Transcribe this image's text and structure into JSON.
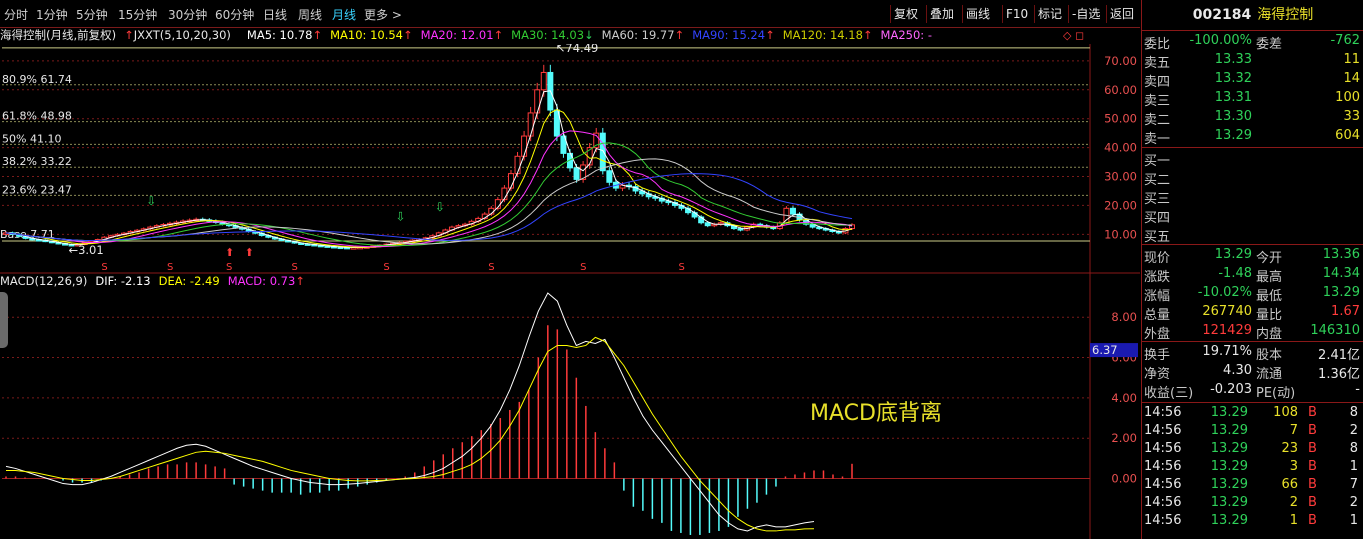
{
  "period_bar": {
    "items": [
      "分时",
      "1分钟",
      "5分钟",
      "15分钟",
      "30分钟",
      "60分钟",
      "日线",
      "周线",
      "月线",
      "更多 >"
    ],
    "active_index": 8,
    "tools": [
      "复权",
      "叠加",
      "画线",
      "F10",
      "标记",
      "-自选",
      "返回"
    ]
  },
  "ma_info": {
    "title": "海得控制(月线,前复权)",
    "indicator": "JXXT(5,10,20,30)",
    "ma5": "MA5: 10.78",
    "ma10": "MA10: 10.54",
    "ma20": "MA20: 12.01",
    "ma30": "MA30: 14.03",
    "ma60": "MA60: 19.77",
    "ma90": "MA90: 15.24",
    "ma120": "MA120: 14.18",
    "ma250": "MA250: -",
    "corner": "◇ ◻"
  },
  "macd_info": {
    "title": "MACD(12,26,9)",
    "dif": "DIF: -2.13",
    "dea": "DEA: -2.49",
    "macd": "MACD: 0.73"
  },
  "annotation": "MACD底背离",
  "stock": {
    "code": "002184",
    "name": "海得控制"
  },
  "order_book": {
    "ratio": {
      "label": "委比",
      "value": "-100.00%",
      "label2": "委差",
      "value2": "-762"
    },
    "asks": [
      {
        "label": "卖五",
        "price": "13.33",
        "vol": "11"
      },
      {
        "label": "卖四",
        "price": "13.32",
        "vol": "14"
      },
      {
        "label": "卖三",
        "price": "13.31",
        "vol": "100"
      },
      {
        "label": "卖二",
        "price": "13.30",
        "vol": "33"
      },
      {
        "label": "卖一",
        "price": "13.29",
        "vol": "604"
      }
    ],
    "bids": [
      {
        "label": "买一"
      },
      {
        "label": "买二"
      },
      {
        "label": "买三"
      },
      {
        "label": "买四"
      },
      {
        "label": "买五"
      }
    ]
  },
  "quote": [
    {
      "l1": "现价",
      "v1": "13.29",
      "l2": "今开",
      "v2": "13.36",
      "c1": "green",
      "c2": "green"
    },
    {
      "l1": "涨跌",
      "v1": "-1.48",
      "l2": "最高",
      "v2": "14.34",
      "c1": "green",
      "c2": "green"
    },
    {
      "l1": "涨幅",
      "v1": "-10.02%",
      "l2": "最低",
      "v2": "13.29",
      "c1": "green",
      "c2": "green"
    },
    {
      "l1": "总量",
      "v1": "267740",
      "l2": "量比",
      "v2": "1.67",
      "c1": "yellow",
      "c2": "red"
    },
    {
      "l1": "外盘",
      "v1": "121429",
      "l2": "内盘",
      "v2": "146310",
      "c1": "red",
      "c2": "green"
    }
  ],
  "fundamentals": [
    {
      "l1": "换手",
      "v1": "19.71%",
      "l2": "股本",
      "v2": "2.41亿"
    },
    {
      "l1": "净资",
      "v1": "4.30",
      "l2": "流通",
      "v2": "1.36亿"
    },
    {
      "l1": "收益(三)",
      "v1": "-0.203",
      "l2": "PE(动)",
      "v2": "-"
    }
  ],
  "ticks": [
    {
      "time": "14:56",
      "price": "13.29",
      "vol": "108",
      "side": "B",
      "n": "8"
    },
    {
      "time": "14:56",
      "price": "13.29",
      "vol": "7",
      "side": "B",
      "n": "2"
    },
    {
      "time": "14:56",
      "price": "13.29",
      "vol": "23",
      "side": "B",
      "n": "8"
    },
    {
      "time": "14:56",
      "price": "13.29",
      "vol": "3",
      "side": "B",
      "n": "1"
    },
    {
      "time": "14:56",
      "price": "13.29",
      "vol": "66",
      "side": "B",
      "n": "7"
    },
    {
      "time": "14:56",
      "price": "13.29",
      "vol": "2",
      "side": "B",
      "n": "2"
    },
    {
      "time": "14:56",
      "price": "13.29",
      "vol": "1",
      "side": "B",
      "n": "1"
    }
  ],
  "chart_data": [
    {
      "type": "candlestick",
      "title": "海得控制(月线,前复权)",
      "y_ticks": [
        10,
        20,
        30,
        40,
        50,
        60,
        70
      ],
      "ylim": [
        7.0,
        75.5
      ],
      "fib_levels": [
        {
          "label": "80.9% 61.74",
          "value": 61.74
        },
        {
          "label": "61.8% 48.98",
          "value": 48.98
        },
        {
          "label": "50% 41.10",
          "value": 41.1
        },
        {
          "label": "38.2% 33.22",
          "value": 33.22
        },
        {
          "label": "23.6% 23.47",
          "value": 23.47
        }
      ],
      "fib_base_label": "Base 7.71",
      "high_label": "74.49",
      "low_label": "3.01",
      "close_series": [
        10.5,
        10.0,
        9.3,
        8.6,
        8.2,
        8.0,
        7.6,
        7.2,
        6.8,
        6.5,
        6.2,
        6.5,
        7.0,
        7.6,
        8.2,
        9.0,
        9.5,
        10.0,
        10.4,
        11.0,
        11.4,
        11.9,
        12.5,
        13.0,
        13.4,
        13.8,
        14.2,
        14.6,
        14.9,
        15.2,
        15.0,
        14.6,
        14.2,
        13.6,
        13.0,
        12.4,
        11.8,
        11.0,
        10.4,
        9.6,
        9.0,
        8.4,
        7.9,
        7.5,
        7.0,
        6.7,
        6.5,
        6.2,
        6.0,
        5.8,
        5.6,
        5.5,
        5.4,
        5.4,
        5.5,
        5.7,
        6.0,
        6.3,
        6.6,
        6.9,
        7.2,
        7.6,
        8.0,
        8.4,
        8.8,
        9.5,
        10.5,
        11.5,
        12.5,
        13.0,
        13.5,
        14.5,
        15.5,
        17.0,
        19.0,
        22.0,
        26.0,
        31.0,
        37.0,
        44.0,
        52.0,
        60.0,
        66.0,
        53.0,
        44.0,
        38.0,
        33.0,
        29.0,
        34.0,
        40.0,
        45.0,
        32.0,
        28.0,
        26.0,
        27.0,
        26.5,
        25.0,
        24.0,
        23.0,
        22.5,
        21.5,
        21.0,
        20.0,
        19.0,
        17.5,
        16.0,
        14.0,
        13.0,
        13.5,
        14.0,
        13.0,
        12.0,
        11.5,
        12.5,
        13.5,
        13.0,
        12.5,
        12.0,
        14.0,
        19.0,
        17.0,
        15.0,
        13.5,
        12.5,
        12.0,
        11.5,
        11.0,
        10.5,
        12.0,
        13.29
      ],
      "ma_colors": {
        "MA5": "#ffffff",
        "MA10": "#ffff00",
        "MA20": "#ff33ff",
        "MA30": "#33cc33",
        "MA60": "#cccccc",
        "MA90": "#3344ff",
        "MA120": "#cccc00",
        "MA250": "#ff66ff"
      }
    },
    {
      "type": "macd",
      "title": "MACD(12,26,9)",
      "y_ticks": [
        0.0,
        2.0,
        4.0,
        6.0,
        8.0
      ],
      "ylim": [
        -3.0,
        9.4
      ],
      "current_marker": "6.37",
      "dif": [
        0.6,
        0.5,
        0.35,
        0.2,
        0.05,
        -0.1,
        -0.25,
        -0.3,
        -0.3,
        -0.2,
        -0.05,
        0.1,
        0.3,
        0.5,
        0.7,
        0.9,
        1.1,
        1.3,
        1.5,
        1.65,
        1.7,
        1.6,
        1.4,
        1.2,
        1.0,
        0.8,
        0.6,
        0.45,
        0.3,
        0.15,
        0.0,
        -0.1,
        -0.2,
        -0.25,
        -0.3,
        -0.3,
        -0.28,
        -0.25,
        -0.2,
        -0.15,
        -0.1,
        -0.05,
        0.0,
        0.05,
        0.15,
        0.3,
        0.5,
        0.8,
        1.1,
        1.5,
        2.0,
        2.6,
        3.4,
        4.4,
        5.6,
        7.0,
        8.3,
        9.2,
        8.8,
        7.6,
        6.6,
        6.8,
        6.7,
        6.9,
        6.0,
        5.0,
        4.0,
        3.1,
        2.4,
        1.8,
        1.2,
        0.6,
        0.0,
        -0.6,
        -1.2,
        -1.8,
        -2.2,
        -2.5,
        -2.6,
        -2.4,
        -2.3,
        -2.4,
        -2.4,
        -2.3,
        -2.2,
        -2.13
      ],
      "dea": [
        0.4,
        0.4,
        0.35,
        0.3,
        0.2,
        0.1,
        0.0,
        -0.05,
        -0.1,
        -0.1,
        -0.05,
        0.0,
        0.1,
        0.25,
        0.4,
        0.55,
        0.7,
        0.85,
        1.0,
        1.15,
        1.3,
        1.35,
        1.3,
        1.25,
        1.15,
        1.05,
        0.95,
        0.85,
        0.7,
        0.55,
        0.4,
        0.3,
        0.2,
        0.1,
        0.0,
        -0.05,
        -0.1,
        -0.12,
        -0.12,
        -0.1,
        -0.08,
        -0.05,
        -0.02,
        0.0,
        0.05,
        0.1,
        0.2,
        0.35,
        0.5,
        0.7,
        1.0,
        1.4,
        1.9,
        2.6,
        3.4,
        4.4,
        5.4,
        6.3,
        6.6,
        6.6,
        6.5,
        6.6,
        7.0,
        6.8,
        6.2,
        5.6,
        4.8,
        4.0,
        3.2,
        2.5,
        1.8,
        1.1,
        0.5,
        -0.1,
        -0.6,
        -1.1,
        -1.6,
        -2.0,
        -2.3,
        -2.5,
        -2.6,
        -2.6,
        -2.55,
        -2.55,
        -2.5,
        -2.49
      ],
      "macd": [
        0.1,
        0.1,
        0.05,
        0.0,
        0.0,
        0.0,
        -0.1,
        -0.2,
        -0.2,
        -0.2,
        -0.1,
        0.0,
        0.1,
        0.2,
        0.3,
        0.5,
        0.6,
        0.7,
        0.7,
        0.8,
        0.8,
        0.7,
        0.6,
        0.5,
        -0.3,
        -0.4,
        -0.5,
        -0.6,
        -0.7,
        -0.7,
        -0.7,
        -0.8,
        -0.7,
        -0.7,
        -0.6,
        -0.6,
        -0.5,
        -0.4,
        -0.3,
        -0.2,
        -0.1,
        0.0,
        0.1,
        0.3,
        0.6,
        0.9,
        1.2,
        1.5,
        1.8,
        2.1,
        2.4,
        2.7,
        3.0,
        3.4,
        3.8,
        4.4,
        6.0,
        7.6,
        7.4,
        6.4,
        5.0,
        3.6,
        2.3,
        1.5,
        0.8,
        -0.6,
        -1.4,
        -1.6,
        -2.0,
        -2.2,
        -2.6,
        -2.7,
        -2.8,
        -2.8,
        -2.7,
        -2.6,
        -2.4,
        -1.9,
        -1.5,
        -1.2,
        -0.8,
        -0.4,
        0.1,
        0.2,
        0.3,
        0.4,
        0.4,
        0.2,
        0.1,
        0.73
      ]
    }
  ]
}
